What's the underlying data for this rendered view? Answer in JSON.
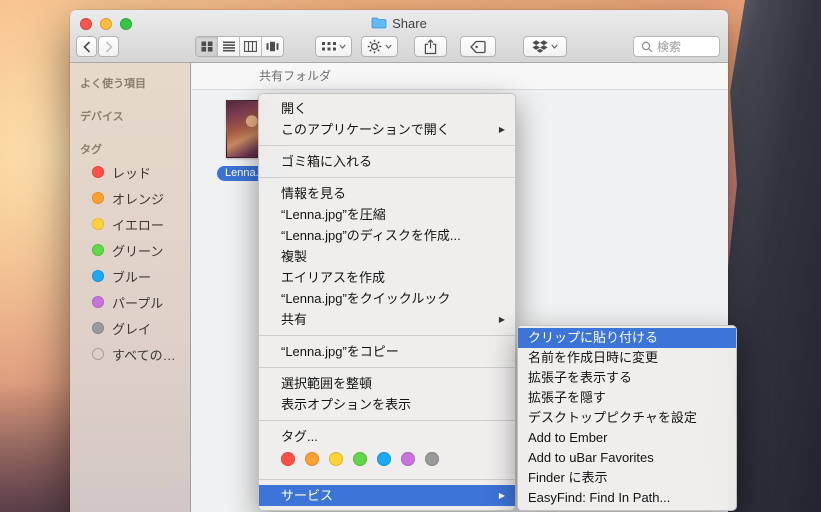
{
  "window": {
    "title": "Share"
  },
  "toolbar": {
    "search_placeholder": "検索"
  },
  "sidebar": {
    "headers": [
      "よく使う項目",
      "デバイス",
      "タグ"
    ],
    "tags": [
      "レッド",
      "オレンジ",
      "イエロー",
      "グリーン",
      "ブルー",
      "パープル",
      "グレイ",
      "すべての…"
    ]
  },
  "tag_colors": [
    "#ff5146",
    "#ffa033",
    "#ffd435",
    "#61d84a",
    "#1ba9f5",
    "#c873dd",
    "#9a9a9a"
  ],
  "content": {
    "header": "共有フォルダ",
    "file_name": "Lenna.jpg"
  },
  "colors": {
    "highlight": "#3d74d8"
  },
  "context_menu": {
    "items": [
      {
        "label": "開く"
      },
      {
        "label": "このアプリケーションで開く",
        "has_submenu": true
      },
      {
        "label": "ゴミ箱に入れる"
      },
      {
        "label": "情報を見る"
      },
      {
        "label": "“Lenna.jpg”を圧縮"
      },
      {
        "label": "“Lenna.jpg”のディスクを作成..."
      },
      {
        "label": "複製"
      },
      {
        "label": "エイリアスを作成"
      },
      {
        "label": "“Lenna.jpg”をクイックルック"
      },
      {
        "label": "共有",
        "has_submenu": true
      },
      {
        "label": "“Lenna.jpg”をコピー"
      },
      {
        "label": "選択範囲を整頓"
      },
      {
        "label": "表示オプションを表示"
      },
      {
        "label": "タグ..."
      },
      {
        "label": "サービス",
        "has_submenu": true,
        "highlighted": true
      }
    ]
  },
  "submenu": {
    "items": [
      {
        "label": "クリップに貼り付ける",
        "highlighted": true
      },
      {
        "label": "名前を作成日時に変更"
      },
      {
        "label": "拡張子を表示する"
      },
      {
        "label": "拡張子を隠す"
      },
      {
        "label": "デスクトップピクチャを設定"
      },
      {
        "label": "Add to Ember"
      },
      {
        "label": "Add to uBar Favorites"
      },
      {
        "label": "Finder に表示"
      },
      {
        "label": "EasyFind: Find In Path..."
      }
    ]
  }
}
